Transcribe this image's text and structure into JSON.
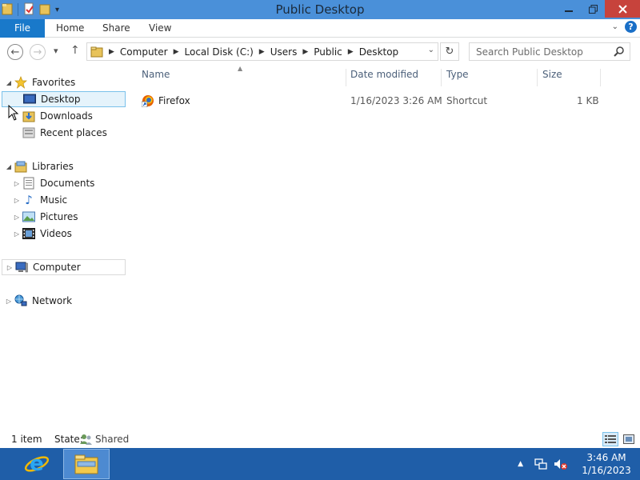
{
  "window": {
    "title": "Public Desktop"
  },
  "ribbon": {
    "file": "File",
    "tabs": [
      "Home",
      "Share",
      "View"
    ]
  },
  "address": {
    "breadcrumbs": [
      "Computer",
      "Local Disk (C:)",
      "Users",
      "Public",
      "Desktop"
    ],
    "search_placeholder": "Search Public Desktop"
  },
  "nav": {
    "favorites": {
      "label": "Favorites",
      "items": [
        "Desktop",
        "Downloads",
        "Recent places"
      ]
    },
    "libraries": {
      "label": "Libraries",
      "items": [
        "Documents",
        "Music",
        "Pictures",
        "Videos"
      ]
    },
    "computer": "Computer",
    "network": "Network"
  },
  "columns": {
    "name": "Name",
    "date": "Date modified",
    "type": "Type",
    "size": "Size"
  },
  "files": [
    {
      "name": "Firefox",
      "date": "1/16/2023 3:26 AM",
      "type": "Shortcut",
      "size": "1 KB"
    }
  ],
  "status": {
    "count": "1 item",
    "state_label": "State:",
    "state_value": "Shared"
  },
  "clock": {
    "time": "3:46 AM",
    "date": "1/16/2023"
  },
  "colors": {
    "titlebar": "#4a90d9",
    "file_tab": "#1979ca",
    "taskbar": "#1f5ea8",
    "close": "#c7433c"
  }
}
